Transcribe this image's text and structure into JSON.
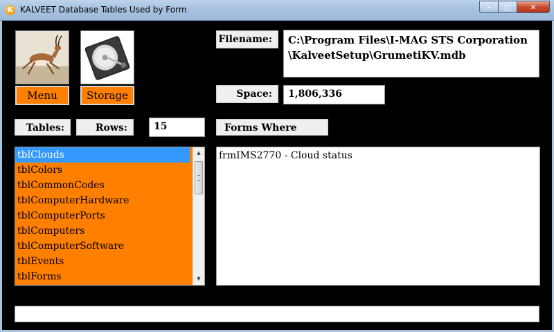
{
  "window": {
    "title": "KALVEET Database Tables Used by Form",
    "app_icon_letter": "K",
    "minimize": "–",
    "maximize": "□",
    "close": "✕"
  },
  "buttons": {
    "menu_label": "Menu",
    "storage_label": "Storage"
  },
  "filename": {
    "label": "Filename:",
    "value_line1": "C:\\Program Files\\I-MAG STS Corporation",
    "value_line2": "\\KalveetSetup\\GrumetiKV.mdb"
  },
  "space": {
    "label": "Space:",
    "value": "1,806,336"
  },
  "tables": {
    "label": "Tables:",
    "rows_label": "Rows:",
    "rows_value": "15",
    "items": [
      "tblClouds",
      "tblColors",
      "tblCommonCodes",
      "tblComputerHardware",
      "tblComputerPorts",
      "tblComputers",
      "tblComputerSoftware",
      "tblEvents",
      "tblForms"
    ],
    "selected_index": 0
  },
  "forms": {
    "label": "Forms Where Used:",
    "items": [
      "frmIMS2770 - Cloud status"
    ]
  },
  "status": {
    "text": ""
  },
  "colors": {
    "list_bg": "#ff7f00",
    "selection": "#3399ff",
    "background": "#000000"
  }
}
